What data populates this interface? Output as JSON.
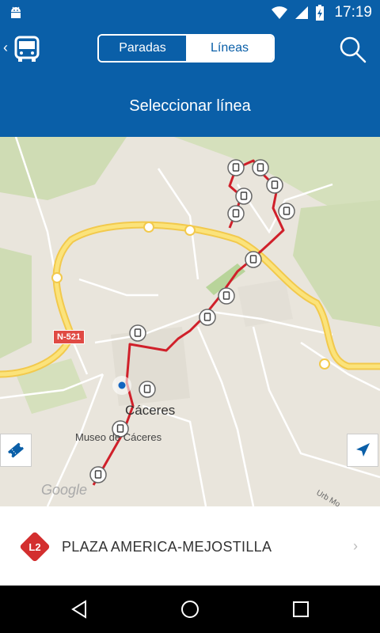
{
  "status": {
    "time": "17:19"
  },
  "segmented": {
    "paradas": "Paradas",
    "lineas": "Líneas"
  },
  "header": {
    "title": "Seleccionar línea"
  },
  "map": {
    "city_label": "Cáceres",
    "museum_label": "Museo de Cáceres",
    "road_label": "N-521",
    "watermark": "Google",
    "street_label": "Urb Mo"
  },
  "line": {
    "badge": "L2",
    "name": "PLAZA AMERICA-MEJOSTILLA",
    "color": "#d32f2f"
  },
  "colors": {
    "primary": "#0a5fa8",
    "route": "#d0202a"
  },
  "icons": [
    "android-icon",
    "wifi-icon",
    "signal-icon",
    "battery-icon",
    "back-icon",
    "bus-icon",
    "search-icon",
    "ticket-icon",
    "navigation-arrow-icon",
    "chevron-right-icon",
    "nav-back-icon",
    "nav-home-icon",
    "nav-recents-icon"
  ]
}
